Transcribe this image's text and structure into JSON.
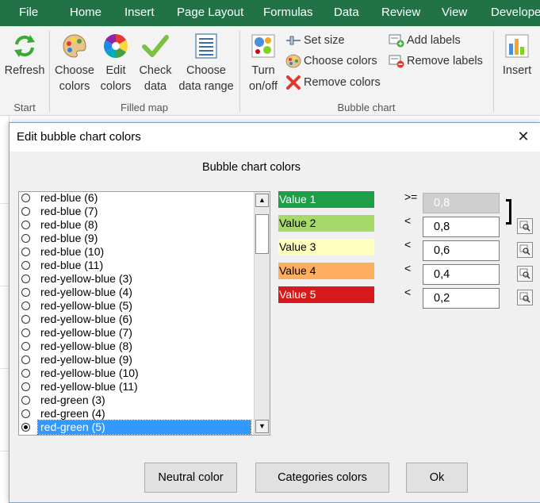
{
  "ribbon_tabs": [
    "File",
    "Home",
    "Insert",
    "Page Layout",
    "Formulas",
    "Data",
    "Review",
    "View",
    "Develope"
  ],
  "ribbon": {
    "start": {
      "refresh_label": "Refresh",
      "group_label": "Start"
    },
    "filled_map": {
      "choose_colors_label": "Choose\ncolors",
      "edit_colors_label": "Edit\ncolors",
      "check_data_label": "Check\ndata",
      "choose_range_label": "Choose\ndata range",
      "group_label": "Filled map"
    },
    "bubble_chart": {
      "turn_label": "Turn\non/off",
      "set_size_label": "Set size",
      "choose_colors_label": "Choose colors",
      "remove_colors_label": "Remove colors",
      "add_labels_label": "Add labels",
      "remove_labels_label": "Remove labels",
      "group_label": "Bubble chart"
    },
    "insert_label": "Insert"
  },
  "dialog": {
    "title": "Edit bubble chart colors",
    "heading": "Bubble chart colors",
    "palette_items": [
      {
        "label": "red-blue (6)",
        "selected": false
      },
      {
        "label": "red-blue (7)",
        "selected": false
      },
      {
        "label": "red-blue (8)",
        "selected": false
      },
      {
        "label": "red-blue (9)",
        "selected": false
      },
      {
        "label": "red-blue (10)",
        "selected": false
      },
      {
        "label": "red-blue (11)",
        "selected": false
      },
      {
        "label": "red-yellow-blue (3)",
        "selected": false
      },
      {
        "label": "red-yellow-blue (4)",
        "selected": false
      },
      {
        "label": "red-yellow-blue (5)",
        "selected": false
      },
      {
        "label": "red-yellow-blue (6)",
        "selected": false
      },
      {
        "label": "red-yellow-blue (7)",
        "selected": false
      },
      {
        "label": "red-yellow-blue (8)",
        "selected": false
      },
      {
        "label": "red-yellow-blue (9)",
        "selected": false
      },
      {
        "label": "red-yellow-blue (10)",
        "selected": false
      },
      {
        "label": "red-yellow-blue (11)",
        "selected": false
      },
      {
        "label": "red-green (3)",
        "selected": false
      },
      {
        "label": "red-green (4)",
        "selected": false
      },
      {
        "label": "red-green (5)",
        "selected": true
      }
    ],
    "values": [
      {
        "label": "Value 1",
        "color": "#1f9e48",
        "text_color": "#ffffff",
        "operator": ">=",
        "value": "0,8",
        "disabled": true
      },
      {
        "label": "Value 2",
        "color": "#a6d96a",
        "text_color": "#000000",
        "operator": "<",
        "value": "0,8",
        "disabled": false
      },
      {
        "label": "Value 3",
        "color": "#ffffbf",
        "text_color": "#000000",
        "operator": "<",
        "value": "0,6",
        "disabled": false
      },
      {
        "label": "Value 4",
        "color": "#fdae61",
        "text_color": "#000000",
        "operator": "<",
        "value": "0,4",
        "disabled": false
      },
      {
        "label": "Value 5",
        "color": "#d7191c",
        "text_color": "#ffffff",
        "operator": "<",
        "value": "0,2",
        "disabled": false
      }
    ],
    "buttons": {
      "neutral": "Neutral color",
      "categories": "Categories colors",
      "ok": "Ok"
    }
  },
  "colors": {
    "excel_green": "#217346",
    "selection_blue": "#3399ff"
  }
}
